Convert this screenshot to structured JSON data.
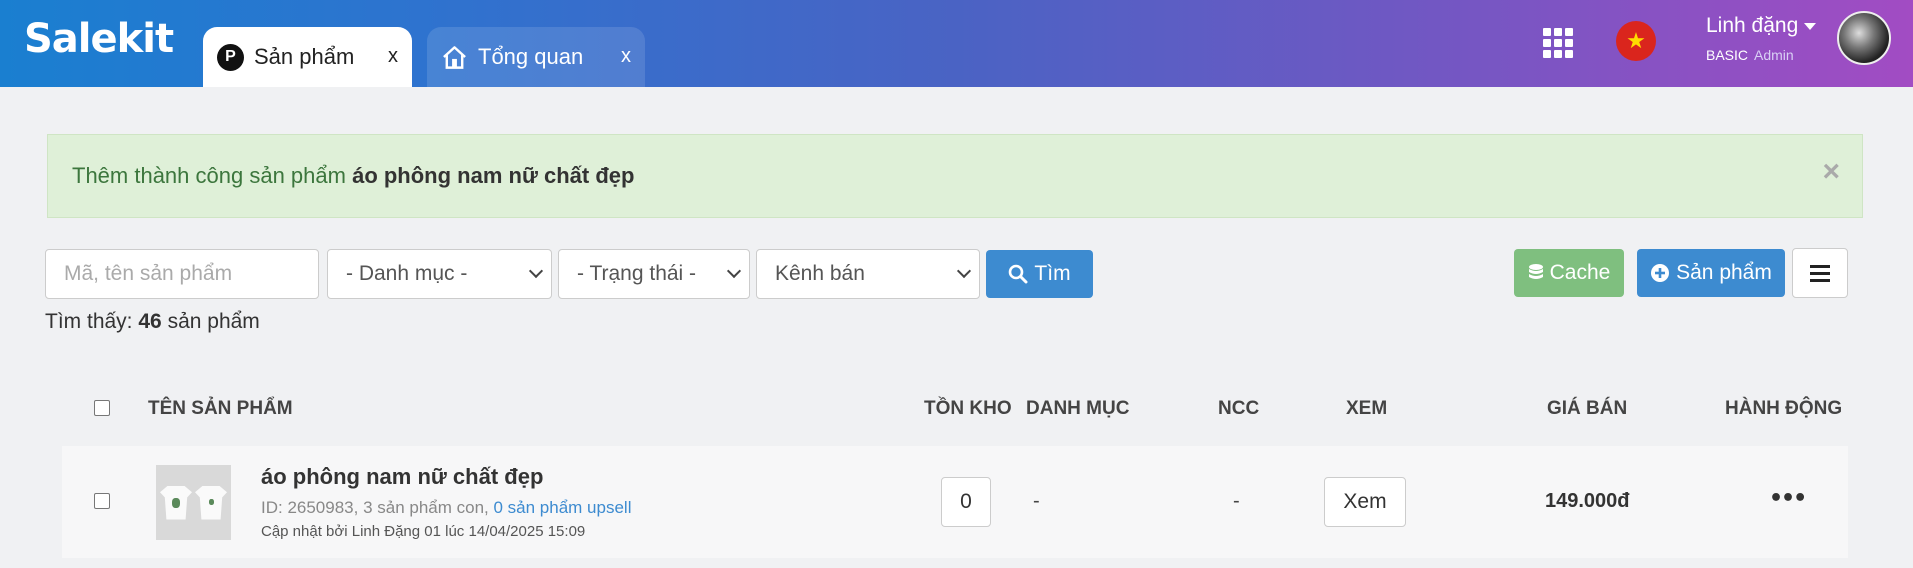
{
  "header": {
    "logo": "Salekit",
    "tabs": [
      {
        "badge": "P",
        "label": "Sản phẩm",
        "close": "x"
      },
      {
        "label": "Tổng quan",
        "close": "x"
      }
    ],
    "user": {
      "name": "Linh đặng",
      "plan": "BASIC",
      "role": "Admin"
    }
  },
  "alert": {
    "message": "Thêm thành công sản phẩm",
    "product": "áo phông nam nữ chất đẹp",
    "close": "×"
  },
  "filters": {
    "search_placeholder": "Mã, tên sản phẩm",
    "category": "- Danh mục -",
    "status": "- Trạng thái -",
    "channel": "Kênh bán",
    "search_button": "Tìm",
    "cache_button": "Cache",
    "add_button": "Sản phẩm"
  },
  "summary": {
    "prefix": "Tìm thấy:",
    "count": "46",
    "suffix": "sản phẩm"
  },
  "table": {
    "headers": {
      "name": "TÊN SẢN PHẨM",
      "stock": "TỒN KHO",
      "category": "DANH MỤC",
      "supplier": "NCC",
      "view": "XEM",
      "price": "GIÁ BÁN",
      "action": "HÀNH ĐỘNG"
    },
    "rows": [
      {
        "name": "áo phông nam nữ chất đẹp",
        "meta": "ID: 2650983, 3 sản phẩm con,",
        "upsell": "0 sản phẩm upsell",
        "updated": "Cập nhật bởi Linh Đặng 01 lúc 14/04/2025 15:09",
        "stock": "0",
        "category": "-",
        "supplier": "-",
        "view": "Xem",
        "price": "149.000đ",
        "action": "•••"
      }
    ]
  },
  "colors": {
    "primary": "#3d8bd0",
    "success": "#7fbf7f",
    "alert_bg": "#dff0d8",
    "alert_text": "#3c763d"
  },
  "icons": [
    "grid-icon",
    "vietnam-flag-icon",
    "search-icon",
    "database-icon",
    "plus-circle-icon",
    "hamburger-icon",
    "home-icon",
    "more-icon"
  ]
}
